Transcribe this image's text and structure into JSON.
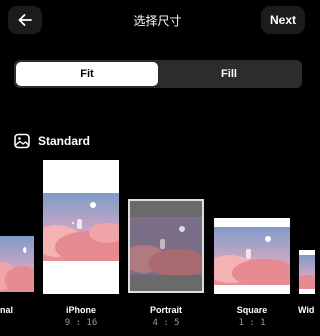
{
  "header": {
    "title": "选择尺寸",
    "back_icon": "arrow-left-icon",
    "next_label": "Next"
  },
  "mode_toggle": {
    "options": [
      {
        "label": "Fit",
        "selected": true
      },
      {
        "label": "Fill",
        "selected": false
      }
    ]
  },
  "section": {
    "icon": "gallery-icon",
    "label": "Standard"
  },
  "sizes": [
    {
      "label": "nal",
      "ratio": ""
    },
    {
      "label": "iPhone",
      "ratio": "9 : 16"
    },
    {
      "label": "Portrait",
      "ratio": "4 : 5",
      "selected": true
    },
    {
      "label": "Square",
      "ratio": "1 : 1"
    },
    {
      "label": "Wid",
      "ratio": ""
    }
  ],
  "colors": {
    "background": "#000000",
    "button_bg": "#1c1c1e",
    "segment_bg": "#2c2c2e",
    "selected_border": "#dddddd",
    "artwork_pink": "#e98d92",
    "artwork_sky": "#9fb6d8"
  }
}
